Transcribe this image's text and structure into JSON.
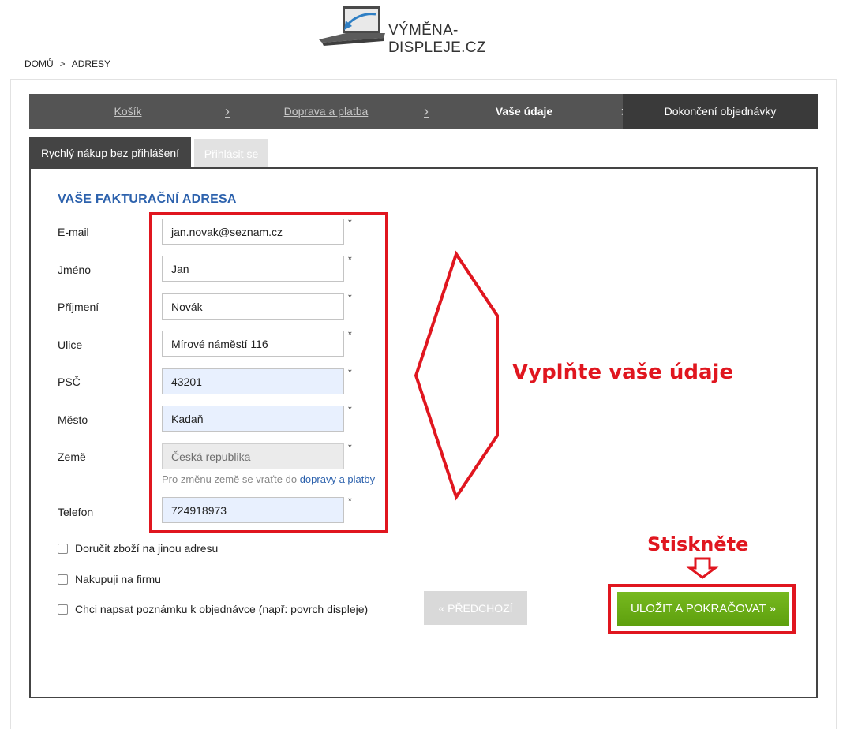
{
  "brand": {
    "name": "VÝMĚNA-DISPLEJE.CZ"
  },
  "breadcrumb": {
    "home": "DOMŮ",
    "separator": ">",
    "current": "ADRESY"
  },
  "steps": [
    {
      "label": "Košík"
    },
    {
      "label": "Doprava a platba"
    },
    {
      "label": "Vaše údaje"
    },
    {
      "label": "Dokončení objednávky"
    }
  ],
  "step_separator": "›",
  "tabs": {
    "quick_buy": "Rychlý nákup bez přihlášení",
    "login": "Přihlásit se"
  },
  "form": {
    "title": "VAŠE FAKTURAČNÍ ADRESA",
    "required_mark": "*",
    "fields": {
      "email": {
        "label": "E-mail",
        "value": "jan.novak@seznam.cz"
      },
      "first_name": {
        "label": "Jméno",
        "value": "Jan"
      },
      "last_name": {
        "label": "Příjmení",
        "value": "Novák"
      },
      "street": {
        "label": "Ulice",
        "value": "Mírové náměstí 116"
      },
      "zip": {
        "label": "PSČ",
        "value": "43201"
      },
      "city": {
        "label": "Město",
        "value": "Kadaň"
      },
      "country": {
        "label": "Země",
        "value": "Česká republika"
      },
      "phone": {
        "label": "Telefon",
        "value": "724918973"
      }
    },
    "country_hint": {
      "text": "Pro změnu země se vraťte do",
      "link": "dopravy a platby"
    },
    "checkboxes": {
      "other_address": "Doručit zboží na jinou adresu",
      "company": "Nakupuji na firmu",
      "note": "Chci napsat poznámku k objednávce (např: povrch displeje)"
    },
    "buttons": {
      "previous": "« PŘEDCHOZÍ",
      "save": "ULOŽIT A POKRAČOVAT »"
    }
  },
  "annotations": {
    "fill_in": "Vyplňte vaše údaje",
    "press": "Stiskněte",
    "color": "#e0161f"
  },
  "colors": {
    "accent_blue": "#2d62ad",
    "save_green": "#6aad15",
    "steps_bar": "#545454"
  }
}
